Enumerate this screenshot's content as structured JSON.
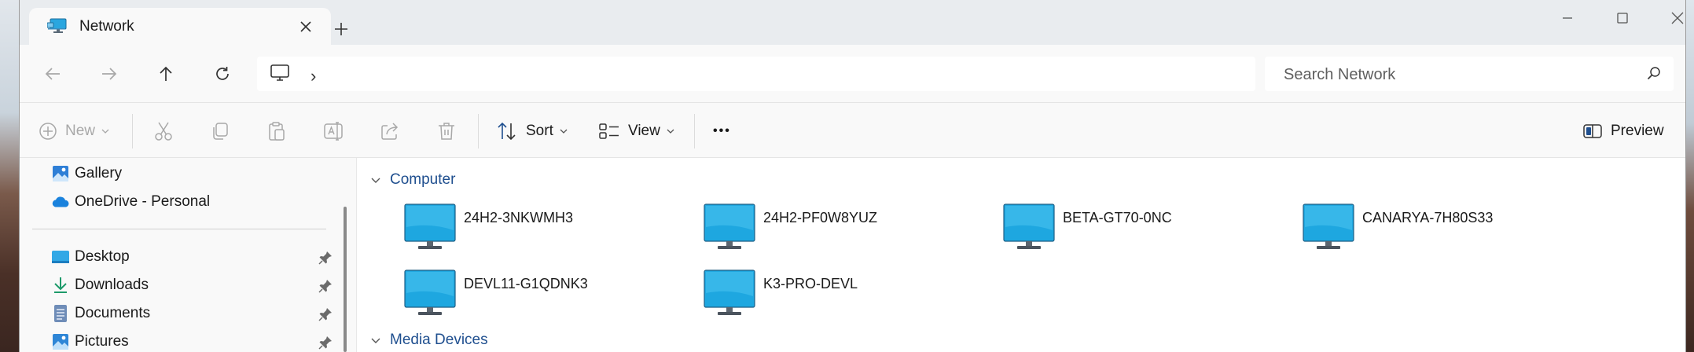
{
  "window": {
    "tab_title": "Network",
    "new_tab_label": "+"
  },
  "address": {
    "breadcrumb_chevron": "›"
  },
  "search": {
    "placeholder": "Search Network"
  },
  "commands": {
    "new_label": "New",
    "sort_label": "Sort",
    "view_label": "View",
    "more_label": "•••",
    "preview_label": "Preview"
  },
  "sidebar": {
    "items": [
      {
        "label": "Gallery",
        "icon": "gallery-icon"
      },
      {
        "label": "OneDrive - Personal",
        "icon": "onedrive-icon"
      },
      {
        "label": "Desktop",
        "icon": "desktop-folder-icon",
        "pinned": true
      },
      {
        "label": "Downloads",
        "icon": "download-icon",
        "pinned": true
      },
      {
        "label": "Documents",
        "icon": "documents-icon",
        "pinned": true
      },
      {
        "label": "Pictures",
        "icon": "pictures-icon",
        "pinned": true
      }
    ]
  },
  "content": {
    "groups": [
      {
        "label": "Computer"
      },
      {
        "label": "Media Devices"
      }
    ],
    "computers": [
      "24H2-3NKWMH3",
      "24H2-PF0W8YUZ",
      "BETA-GT70-0NC",
      "CANARYA-7H80S33",
      "DEVL11-G1QDNK3",
      "K3-PRO-DEVL"
    ]
  },
  "colors": {
    "accent_link": "#1f4f8f",
    "monitor_blue": "#1ea7e0"
  }
}
